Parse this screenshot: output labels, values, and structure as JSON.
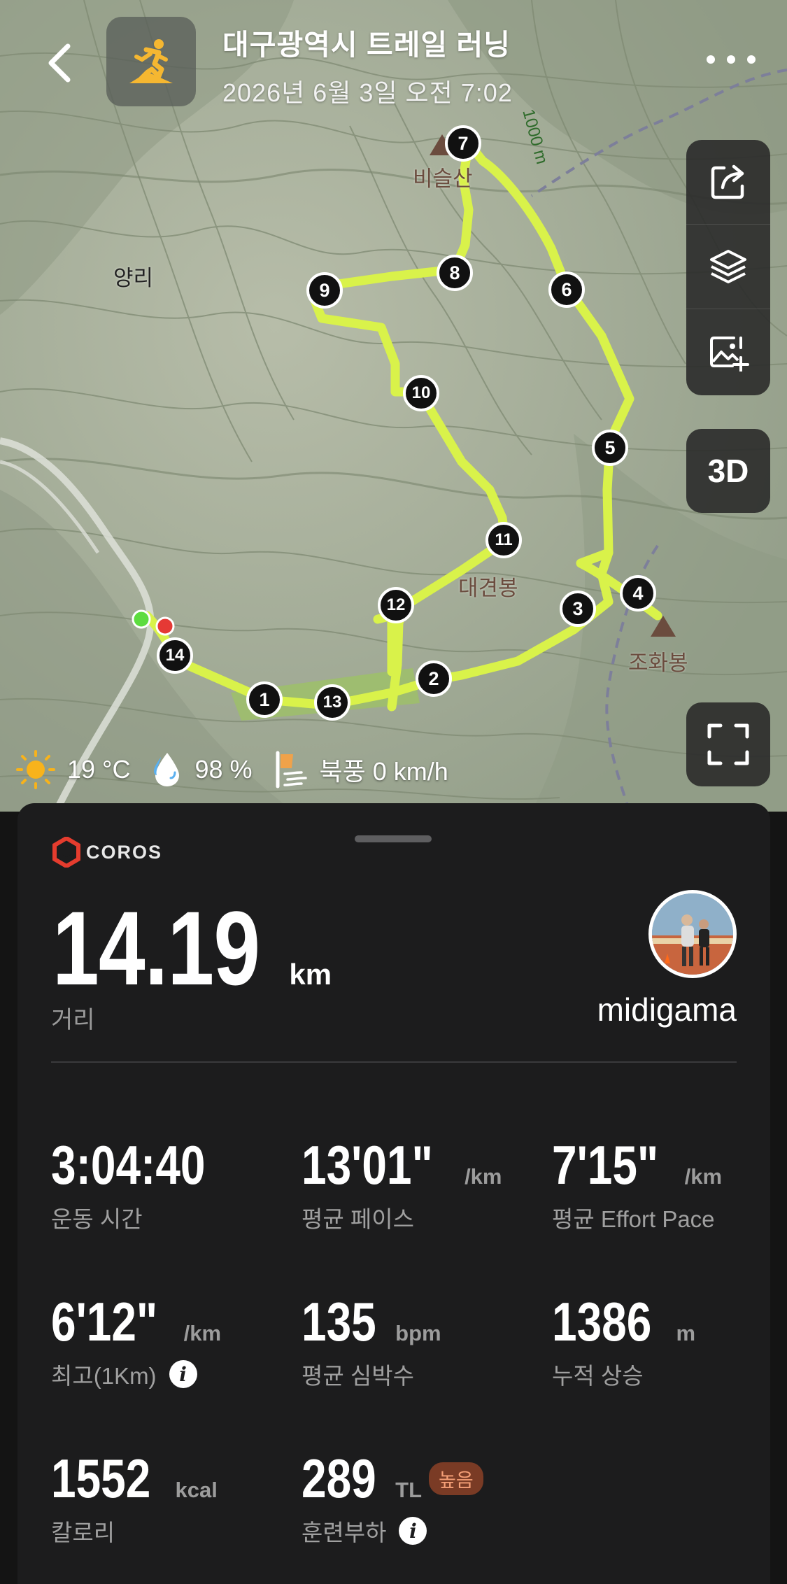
{
  "header": {
    "title": "대구광역시 트레일 러닝",
    "subtitle": "2026년 6월 3일 오전 7:02",
    "activity_icon": "trail-running-icon",
    "accent_color": "#f5b731"
  },
  "map": {
    "place_labels": [
      "양리"
    ],
    "peaks": [
      "비슬산",
      "대견봉",
      "조화봉"
    ],
    "contour_label": "1000 m",
    "route_color": "#d9f24a",
    "km_markers": [
      "1",
      "2",
      "3",
      "4",
      "5",
      "6",
      "7",
      "8",
      "9",
      "10",
      "11",
      "12",
      "13",
      "14"
    ],
    "toolbar": {
      "share_icon": "share-icon",
      "layers_icon": "layers-icon",
      "add_photo_icon": "add-photo-icon",
      "view_3d_label": "3D",
      "fullscreen_icon": "fullscreen-icon"
    }
  },
  "weather": {
    "temperature": "19 °C",
    "humidity": "98 %",
    "wind": "북풍 0 km/h"
  },
  "summary": {
    "brand": "COROS",
    "distance_value": "14.19",
    "distance_unit": "km",
    "distance_label": "거리",
    "username": "midigama",
    "stats": [
      {
        "value": "3:04:40",
        "unit": "",
        "label": "운동 시간"
      },
      {
        "value": "13'01\"",
        "unit": "/km",
        "label": "평균 페이스"
      },
      {
        "value": "7'15\"",
        "unit": "/km",
        "label": "평균 Effort Pace"
      },
      {
        "value": "6'12\"",
        "unit": "/km",
        "label": "최고(1Km)"
      },
      {
        "value": "135",
        "unit": "bpm",
        "label": "평균 심박수"
      },
      {
        "value": "1386",
        "unit": "m",
        "label": "누적 상승"
      },
      {
        "value": "1552",
        "unit": "kcal",
        "label": "칼로리"
      },
      {
        "value": "289",
        "unit": "TL",
        "label": "훈련부하",
        "badge": "높음"
      }
    ]
  }
}
